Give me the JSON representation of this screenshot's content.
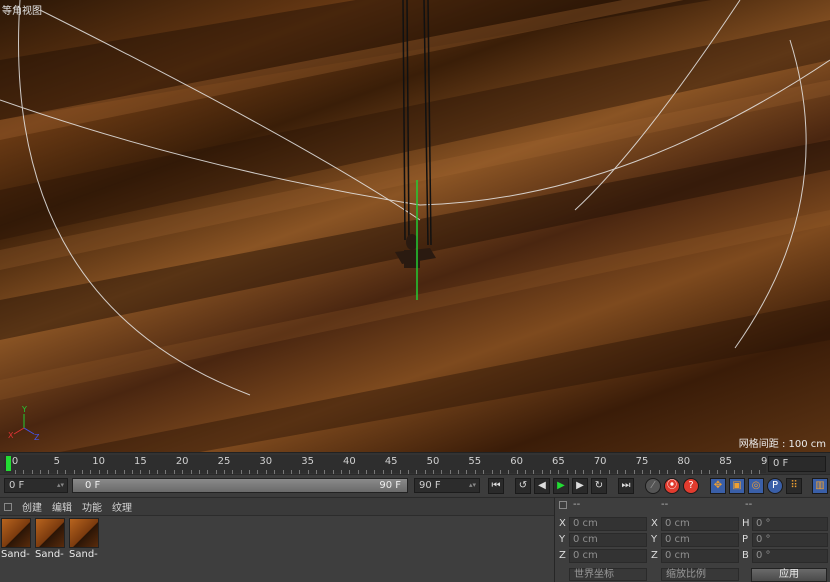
{
  "viewport": {
    "title": "等角视图",
    "grid_spacing": "网格间距 : 100 cm"
  },
  "timeline": {
    "ticks": [
      "0",
      "5",
      "10",
      "15",
      "20",
      "25",
      "30",
      "35",
      "40",
      "45",
      "50",
      "55",
      "60",
      "65",
      "70",
      "75",
      "80",
      "85",
      "90"
    ],
    "current_frame": "0 F"
  },
  "transport": {
    "start_field": "0 F",
    "range_start": "0 F",
    "range_end": "90 F",
    "end_field": "90 F",
    "buttons": {
      "goto_start": "⏮",
      "prev_key": "↺",
      "prev_frame": "◀",
      "play": "▶",
      "next_frame": "▶",
      "next_key": "↻",
      "goto_end": "⏭",
      "record": "●",
      "autokey": "⦿",
      "keyframe_sel": "?",
      "pos_key": "✥",
      "scale_key": "▣",
      "rot_key": "◎",
      "param_key": "P",
      "pla_key": "⠿",
      "timeline_key": "▥"
    }
  },
  "materials": {
    "menu": [
      "创建",
      "编辑",
      "功能",
      "纹理"
    ],
    "items": [
      {
        "name": "Sand-"
      },
      {
        "name": "Sand-"
      },
      {
        "name": "Sand-"
      }
    ]
  },
  "coordinates": {
    "headers": [
      "--",
      "--",
      "--"
    ],
    "rows": [
      {
        "l1": "X",
        "v1": "0 cm",
        "l2": "X",
        "v2": "0 cm",
        "l3": "H",
        "v3": "0 °"
      },
      {
        "l1": "Y",
        "v1": "0 cm",
        "l2": "Y",
        "v2": "0 cm",
        "l3": "P",
        "v3": "0 °"
      },
      {
        "l1": "Z",
        "v1": "0 cm",
        "l2": "Z",
        "v2": "0 cm",
        "l3": "B",
        "v3": "0 °"
      }
    ],
    "space_dropdown": "世界坐标",
    "scale_dropdown": "缩放比例",
    "apply": "应用"
  },
  "colors": {
    "playhead": "#22dd33",
    "record": "#e23b2e",
    "autokey": "#e23b2e",
    "key_active": "#e0a23a",
    "axis_y": "#22cc33"
  }
}
